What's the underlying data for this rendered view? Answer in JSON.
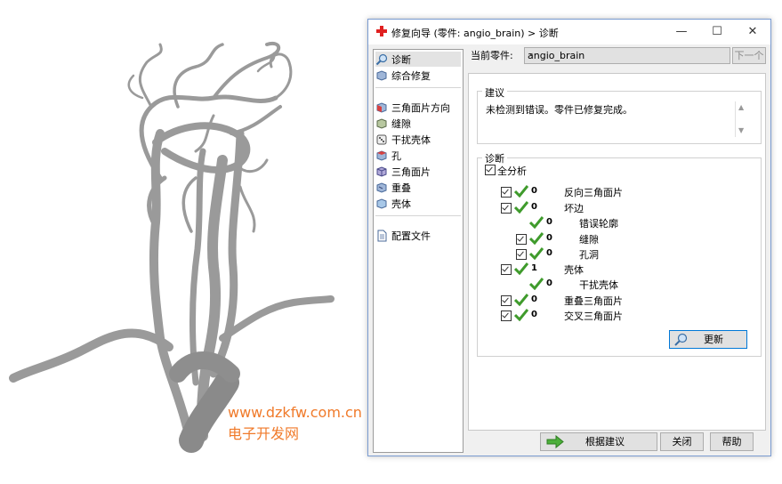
{
  "dialog": {
    "title": "修复向导 (零件: angio_brain) > 诊断",
    "window_buttons": {
      "minimize": "—",
      "maximize": "☐",
      "close": "✕"
    }
  },
  "nav": {
    "items": [
      {
        "label": "诊断",
        "icon": "magnifier-icon",
        "selected": true
      },
      {
        "label": "综合修复",
        "icon": "cube-icon"
      },
      {
        "label": "三角面片方向",
        "icon": "cube-red-icon"
      },
      {
        "label": "缝隙",
        "icon": "cube-gap-icon"
      },
      {
        "label": "干扰壳体",
        "icon": "dice-icon"
      },
      {
        "label": "孔",
        "icon": "cube-hole-icon"
      },
      {
        "label": "三角面片",
        "icon": "cube-triangle-icon"
      },
      {
        "label": "重叠",
        "icon": "cube-overlap-icon"
      },
      {
        "label": "壳体",
        "icon": "cube-shell-icon"
      },
      {
        "label": "配置文件",
        "icon": "document-icon"
      }
    ]
  },
  "part": {
    "label": "当前零件:",
    "value": "angio_brain",
    "next_label": "下一个"
  },
  "advice": {
    "title": "建议",
    "text": "未检测到错误。零件已修复完成。"
  },
  "diagnosis": {
    "title": "诊断",
    "full_analysis_label": "全分析",
    "rows": [
      {
        "count": "0",
        "label": "反向三角面片",
        "checkbox": true
      },
      {
        "count": "0",
        "label": "坏边",
        "checkbox": true
      },
      {
        "count": "0",
        "label": "错误轮廓",
        "checkbox": false
      },
      {
        "count": "0",
        "label": "缝隙",
        "checkbox": true
      },
      {
        "count": "0",
        "label": "孔洞",
        "checkbox": true
      },
      {
        "count": "1",
        "label": "壳体",
        "checkbox": true
      },
      {
        "count": "0",
        "label": "干扰壳体",
        "checkbox": false
      },
      {
        "count": "0",
        "label": "重叠三角面片",
        "checkbox": true
      },
      {
        "count": "0",
        "label": "交叉三角面片",
        "checkbox": true
      }
    ],
    "update_label": "更新"
  },
  "footer": {
    "apply_label": "根据建议",
    "close_label": "关闭",
    "help_label": "帮助"
  },
  "watermark": {
    "url": "www.dzkfw.com.cn",
    "name": "电子开发网"
  },
  "colors": {
    "check_green": "#3f9b2c",
    "accent_blue": "#0078d7",
    "title_red": "#e02020",
    "watermark": "#f07a2a"
  }
}
